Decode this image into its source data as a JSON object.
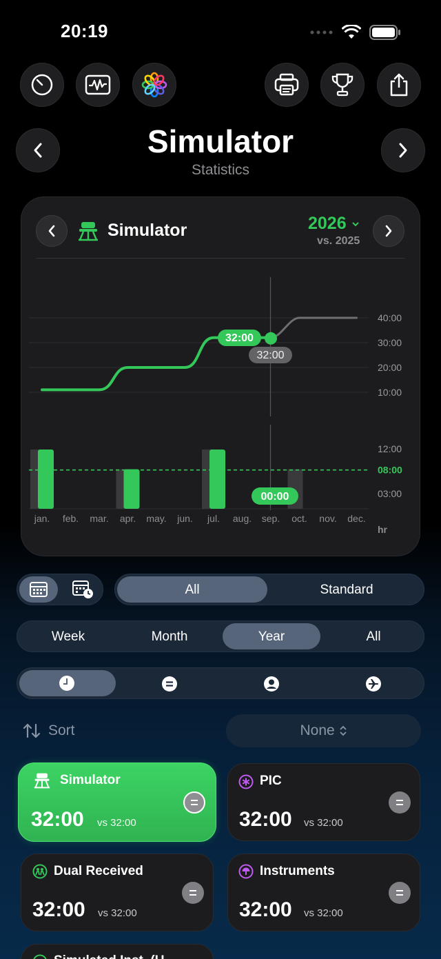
{
  "status": {
    "time": "20:19"
  },
  "header": {
    "title": "Simulator",
    "subtitle": "Statistics"
  },
  "card": {
    "title": "Simulator",
    "year": "2026",
    "compare": "vs. 2025"
  },
  "chart_data": {
    "type": "line+bar",
    "categories": [
      "jan.",
      "feb.",
      "mar.",
      "apr.",
      "may.",
      "jun.",
      "jul.",
      "aug.",
      "sep.",
      "oct.",
      "nov.",
      "dec."
    ],
    "cumulative_ylabels": [
      "40:00",
      "30:00",
      "20:00",
      "10:00"
    ],
    "cumulative_current": [
      11,
      11,
      11,
      20,
      20,
      20,
      32,
      32,
      32
    ],
    "cumulative_previous_tail": [
      32,
      40,
      40,
      40
    ],
    "cursor_label_current": "32:00",
    "cursor_label_previous": "32:00",
    "monthly_ylabels": [
      "12:00",
      "03:00"
    ],
    "monthly_values": [
      12,
      0,
      0,
      8,
      0,
      0,
      12,
      0,
      0,
      0,
      0,
      0
    ],
    "monthly_previous": [
      12,
      0,
      0,
      8,
      0,
      0,
      12,
      0,
      0,
      8,
      0,
      0
    ],
    "average_label": "08:00",
    "average_value": 8,
    "cursor_bar_label": "00:00",
    "unit": "hr",
    "colors": {
      "current": "#34c759",
      "previous": "#6e6e73",
      "average": "#34c759"
    }
  },
  "controls": {
    "type_options": [
      "All",
      "Standard"
    ],
    "type_selected": "All",
    "period_options": [
      "Week",
      "Month",
      "Year",
      "All"
    ],
    "period_selected": "Year",
    "metric_icons": [
      "clock-icon",
      "equals-icon",
      "person-icon",
      "airplane-icon"
    ],
    "sort_label": "Sort",
    "sort_value": "None"
  },
  "tiles": [
    {
      "title": "Simulator",
      "value": "32:00",
      "vs": "vs 32:00",
      "icon": "simulator-icon"
    },
    {
      "title": "PIC",
      "value": "32:00",
      "vs": "vs 32:00",
      "icon": "asterisk-icon"
    },
    {
      "title": "Dual Received",
      "value": "32:00",
      "vs": "vs 32:00",
      "icon": "people-icon"
    },
    {
      "title": "Instruments",
      "value": "32:00",
      "vs": "vs 32:00",
      "icon": "instrument-icon"
    }
  ],
  "partial_tile": {
    "title": "Simulated Inst. (U"
  }
}
